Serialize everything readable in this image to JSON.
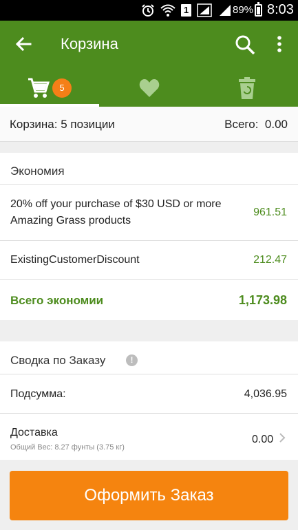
{
  "status_bar": {
    "battery": "89%",
    "time": "8:03",
    "sim": "1"
  },
  "app_bar": {
    "title": "Корзина",
    "cart_badge": "5"
  },
  "cart_summary": {
    "items_label": "Корзина: 5 позиции",
    "total_label": "Всего:",
    "total_value": "0.00"
  },
  "savings": {
    "heading": "Экономия",
    "items": [
      {
        "label_line1": "20% off your purchase of $30 USD or more",
        "label_line2": "Amazing Grass products",
        "value": "961.51"
      },
      {
        "label_line1": "ExistingCustomerDiscount",
        "value": "212.47"
      }
    ],
    "total_label": "Всего экономии",
    "total_value": "1,173.98"
  },
  "order_summary": {
    "heading": "Сводка по Заказу",
    "info": "!",
    "subtotal_label": "Подсумма:",
    "subtotal_value": "4,036.95",
    "shipping_label": "Доставка",
    "shipping_weight": "Общий Вес: 8.27 фунты (3.75 кг)",
    "shipping_value": "0.00"
  },
  "checkout_label": "Оформить Заказ",
  "colors": {
    "brand_green": "#4d8c1e",
    "checkout_orange": "#f5840f",
    "badge_orange": "#f57f17"
  }
}
